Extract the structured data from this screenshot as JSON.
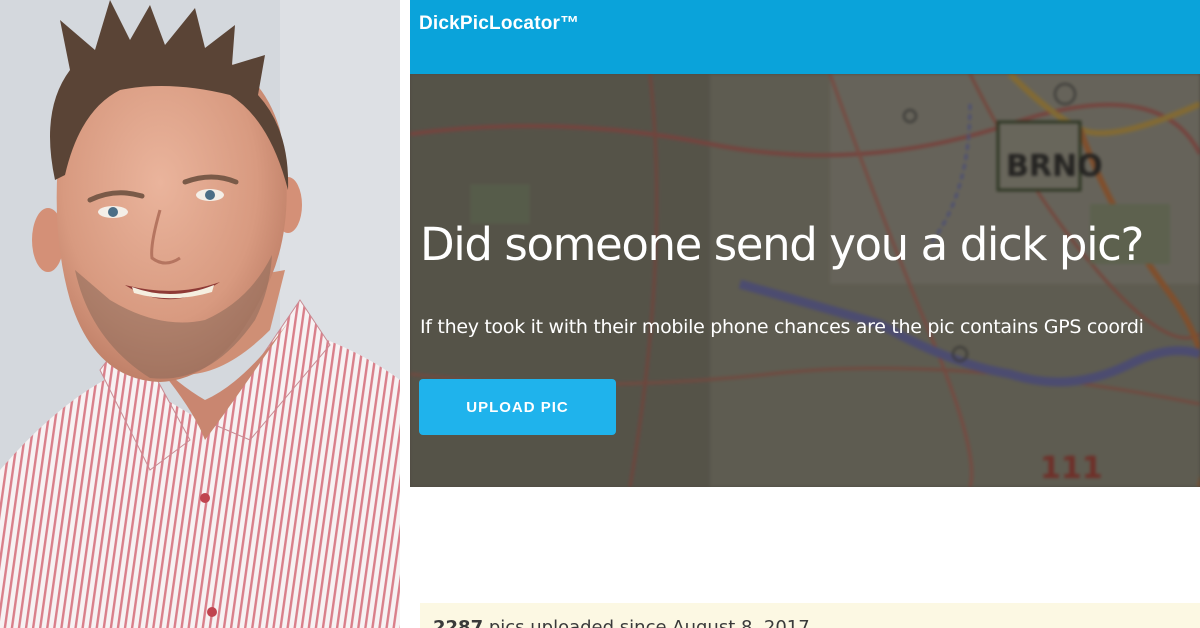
{
  "photo": {
    "subject": "portrait-photo"
  },
  "site": {
    "brand": "DickPicLocator™",
    "colors": {
      "navbar": "#0aa3da",
      "button": "#1fb3ec",
      "counter_bg": "#fcf8e3"
    },
    "hero": {
      "map_labels": {
        "city": "BRNO",
        "road": "111"
      },
      "title": "Did someone send you a dick pic?",
      "text": "If they took it with their mobile phone chances are the pic contains GPS coordi",
      "upload_button": "UPLOAD PIC"
    },
    "counter": {
      "count": "2287",
      "text": " pics uploaded since August 8, 2017"
    }
  }
}
